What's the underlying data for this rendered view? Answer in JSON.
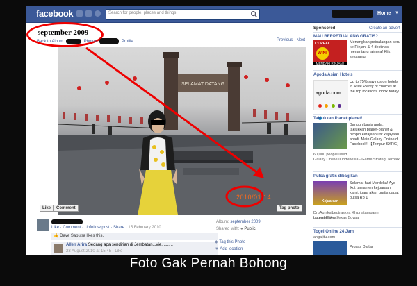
{
  "topbar": {
    "logo": "facebook",
    "search_placeholder": "Search for people, places and things",
    "home_label": "Home"
  },
  "photo_page": {
    "album_title": "september 2009",
    "back_to_album": "Back to Album",
    "photos_text": "Photos",
    "profile_text": "Profile",
    "prev_next": "Previous · Next",
    "like_button": "Like",
    "comment_button": "Comment",
    "tag_photo_button": "Tag photo",
    "photo_timestamp": "2010/01/14",
    "gate_sign": "SELAMAT DATANG",
    "post_actions": "Like · Comment · Unfollow post · Share ·",
    "post_date": "15 February 2010",
    "likes_text": "Dave Saputra likes this.",
    "commenter_name": "Allen Arira",
    "comment_text": "Sedang apa sendirian di Jembatan...vie..........",
    "comment_date": "23 August 2010 at 15:45 · Like",
    "album_label": "Album:",
    "album_value": "september 2009",
    "shared_label": "Shared with:",
    "shared_value": "Public",
    "tag_this_photo": "Tag this Photo",
    "add_location": "Add location"
  },
  "sidebar": {
    "sponsored": "Sponsored",
    "create_advert": "Create an advert",
    "ads": [
      {
        "title": "MAU BERPETUALANG GRATIS?",
        "text": "Menangkan petualangan seru ke Rinjani & 4 destinasi menantang lainnya! Klik sekarang!",
        "img_caption": "MENDAKI RINJANI!",
        "img_brand": "L'OREAL",
        "img_badge": "WIN!"
      },
      {
        "title": "Agoda Asian Hotels",
        "text": "Up to 75% savings on hotels in Asia! Plenty of choices at the top locations. book today!",
        "img_brand": "agoda.com"
      },
      {
        "title": "Taklukkan Planet-planet!",
        "text": "Bangun basis anda, taklukkan planet-planet & pimpin kerajaan utk kejayaan abadi. Main Galaxy Online di Facebook! 【Tempur SKRG】",
        "extra1": "60,000 people used",
        "extra2": "Galaxy Online II Indonesia - Game Strategi Terbaik"
      },
      {
        "title": "Pulsa gratis dibagikan",
        "text": "Selamat hari Merdeka! Ayo ikut turnamen kejuaraan kami, juara akan gratis dapat pulsa Rp 1",
        "extra1": "DruAghiksibeutraskya Xhipriatampann Luphyoullways",
        "extra2": "played Poker Texas Boyaa.",
        "img_caption": "Kejuaraan"
      },
      {
        "title": "Togel Online 24 Jam",
        "text": "",
        "extra1": "angajitu.com",
        "extra2": "Prosas Daftar"
      }
    ]
  },
  "caption": "Foto Gak Pernah Bohong",
  "colors": {
    "brand": "#3b5998",
    "annotation": "#ee0000",
    "background": "#0b0b0b"
  }
}
